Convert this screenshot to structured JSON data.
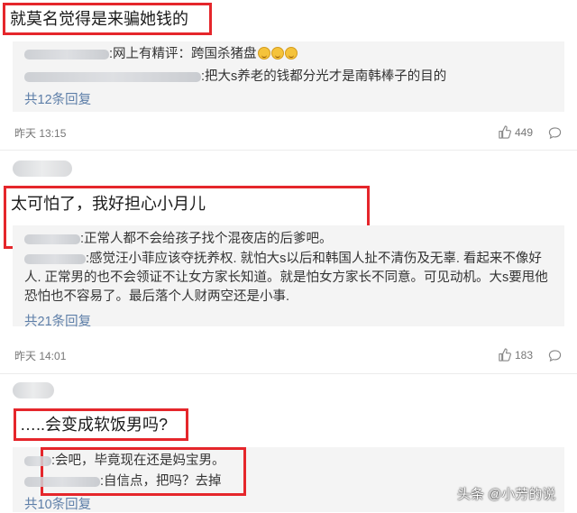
{
  "comments": [
    {
      "text": "就莫名觉得是来骗她钱的",
      "replies": [
        {
          "text": ":网上有精评：跨国杀猪盘",
          "emoji_count": 3
        },
        {
          "text": ":把大s养老的钱都分光才是南韩棒子的目的"
        }
      ],
      "more_replies": "共12条回复",
      "time": "昨天 13:15",
      "likes": "449"
    },
    {
      "text": "太可怕了，我好担心小月儿",
      "replies": [
        {
          "text": ":正常人都不会给孩子找个混夜店的后爹吧。"
        },
        {
          "text": ":感觉汪小菲应该夺抚养权. 就怕大s以后和韩国人扯不清伤及无辜. 看起来不像好人. 正常男的也不会领证不让女方家长知道。就是怕女方家长不同意。可见动机。大s要甩他恐怕也不容易了。最后落个人财两空还是小事."
        }
      ],
      "more_replies": "共21条回复",
      "time": "昨天 14:01",
      "likes": "183"
    },
    {
      "text": "…..会变成软饭男吗?",
      "replies": [
        {
          "text": ":会吧，毕竟现在还是妈宝男。"
        },
        {
          "text": ":自信点，把吗？去掉"
        }
      ],
      "more_replies": "共10条回复"
    }
  ],
  "watermark": "头条 @小芳的说",
  "icons": {
    "like": "thumbs-up-icon",
    "comment": "comment-bubble-icon",
    "emoji": "laughing-emoji-icon"
  },
  "colors": {
    "highlight": "#e5262b",
    "link": "#5d7ea8",
    "panel": "#f4f4f4"
  }
}
